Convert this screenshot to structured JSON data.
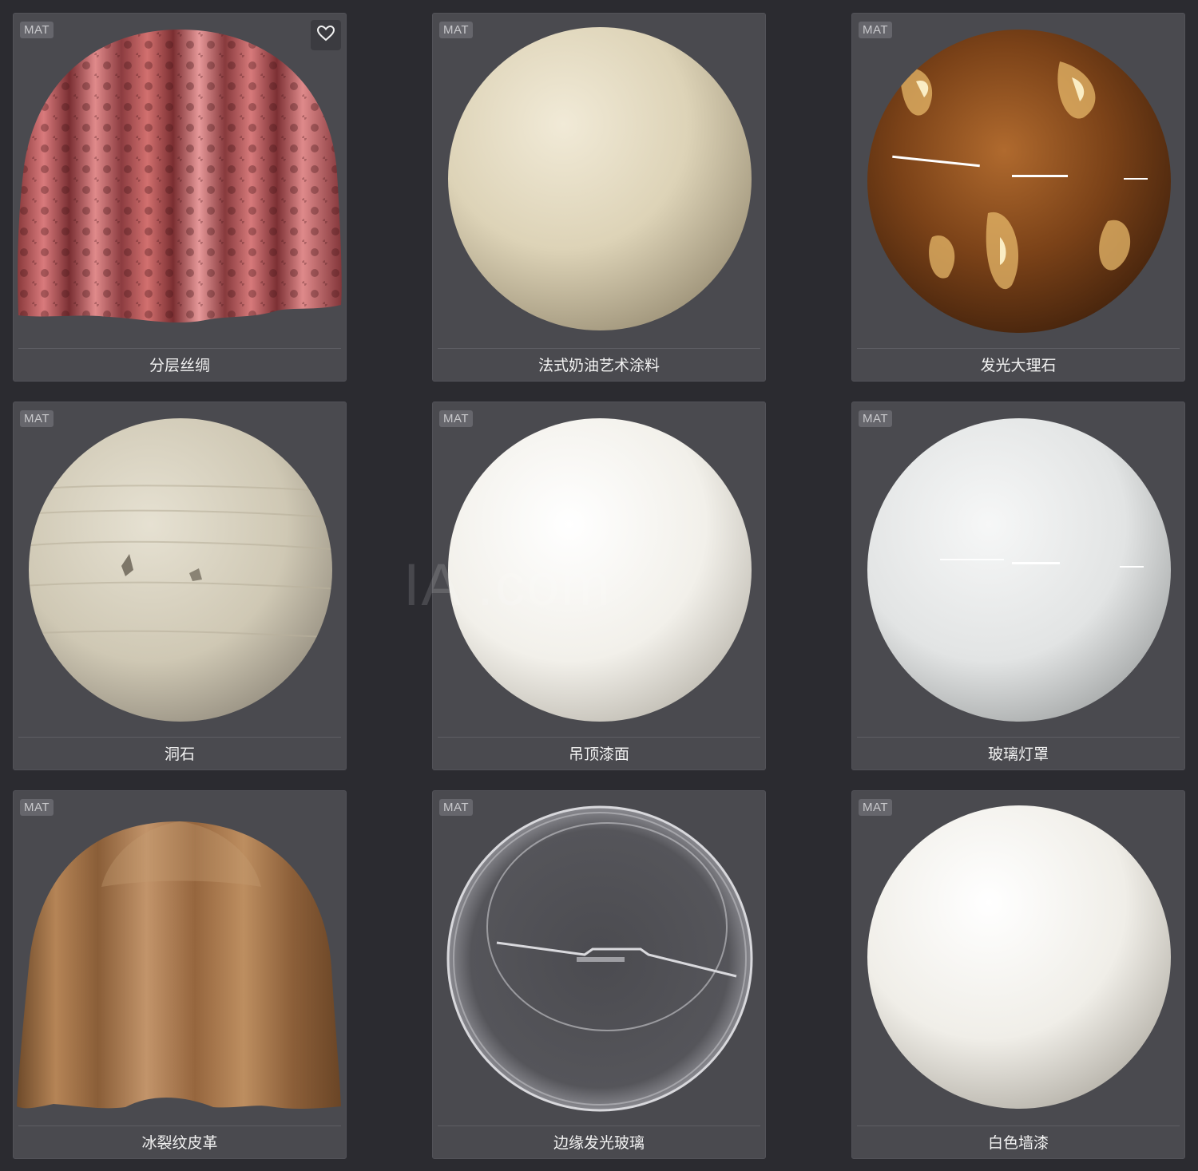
{
  "badge_label": "MAT",
  "watermark": "IA        .com",
  "materials": [
    {
      "name": "分层丝绸",
      "preview": "drape-silk-red",
      "favorite_icon": "heart-outline-icon"
    },
    {
      "name": "法式奶油艺术涂料",
      "preview": "sphere-cream"
    },
    {
      "name": "发光大理石",
      "preview": "sphere-brown-marble"
    },
    {
      "name": "洞石",
      "preview": "sphere-travertine"
    },
    {
      "name": "吊顶漆面",
      "preview": "sphere-white-matte"
    },
    {
      "name": "玻璃灯罩",
      "preview": "sphere-white-glossy"
    },
    {
      "name": "冰裂纹皮革",
      "preview": "drape-leather-brown"
    },
    {
      "name": "边缘发光玻璃",
      "preview": "sphere-clear-glass"
    },
    {
      "name": "白色墙漆",
      "preview": "sphere-white-paint"
    }
  ]
}
